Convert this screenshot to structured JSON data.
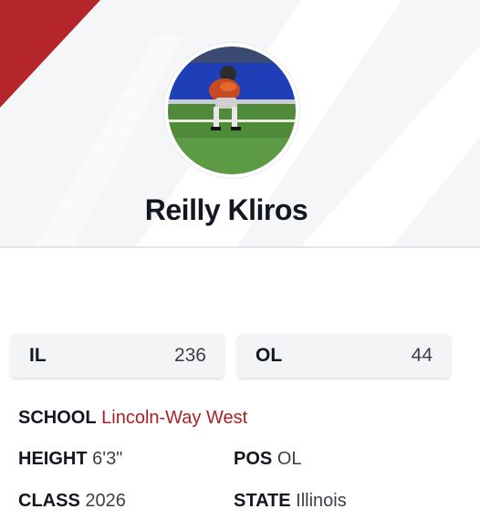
{
  "player": {
    "name": "Reilly Kliros"
  },
  "stats": [
    {
      "label": "IL",
      "value": "236"
    },
    {
      "label": "OL",
      "value": "44"
    }
  ],
  "details": {
    "school_label": "SCHOOL",
    "school_value": "Lincoln-Way West",
    "height_label": "HEIGHT",
    "height_value": "6'3\"",
    "pos_label": "POS",
    "pos_value": "OL",
    "class_label": "CLASS",
    "class_value": "2026",
    "state_label": "STATE",
    "state_value": "Illinois"
  },
  "colors": {
    "accent": "#a92128",
    "corner": "#b5262b",
    "text_dark": "#141722",
    "text_mid": "#3c3f46",
    "card_bg": "#f3f4f6"
  }
}
